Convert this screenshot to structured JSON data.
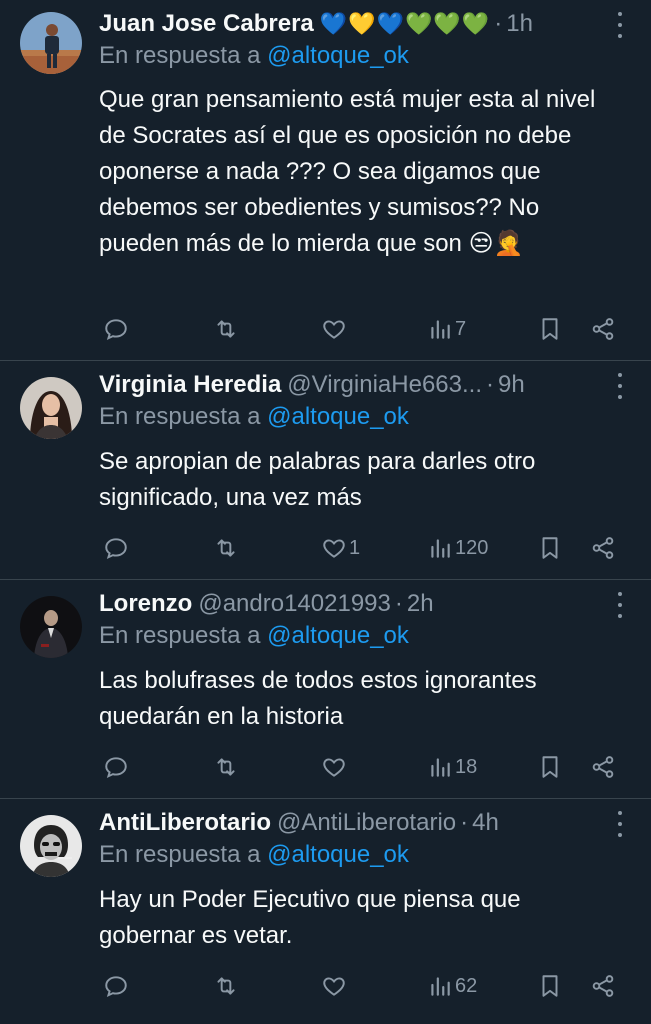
{
  "replying_prefix": "En respuesta a",
  "mention": "@altoque_ok",
  "colors": {
    "background": "#15202b",
    "accent": "#1d9bf0",
    "muted": "#8b98a5",
    "divider": "#38444d"
  },
  "replies": [
    {
      "name": "Juan Jose Cabrera",
      "handle": "",
      "time": "1h",
      "hearts": [
        "💙",
        "💛",
        "💙",
        "💚",
        "💚",
        "💚"
      ],
      "text": "Que gran pensamiento está mujer esta al nivel de Socrates así el que es oposición no debe oponerse a nada ??? O sea digamos que debemos ser obedientes y sumisos?? No pueden más de lo mierda que son 😒🤦",
      "stats": {
        "replies": "",
        "reposts": "",
        "likes": "",
        "views": "7"
      }
    },
    {
      "name": "Virginia Heredia",
      "handle": "@VirginiaHe663...",
      "time": "9h",
      "text": "Se apropian de palabras para darles otro significado, una vez más",
      "stats": {
        "replies": "",
        "reposts": "",
        "likes": "1",
        "views": "120"
      }
    },
    {
      "name": "Lorenzo",
      "handle": "@andro14021993",
      "time": "2h",
      "text": "Las bolufrases de todos estos ignorantes quedarán en la historia",
      "stats": {
        "replies": "",
        "reposts": "",
        "likes": "",
        "views": "18"
      }
    },
    {
      "name": "AntiLiberotario",
      "handle": "@AntiLiberotario",
      "time": "4h",
      "text": "Hay un Poder Ejecutivo que piensa que gobernar es vetar.",
      "stats": {
        "replies": "",
        "reposts": "",
        "likes": "",
        "views": "62"
      }
    }
  ],
  "icons": [
    "reply-icon",
    "repost-icon",
    "like-icon",
    "views-icon",
    "bookmark-icon",
    "share-icon",
    "more-icon"
  ]
}
